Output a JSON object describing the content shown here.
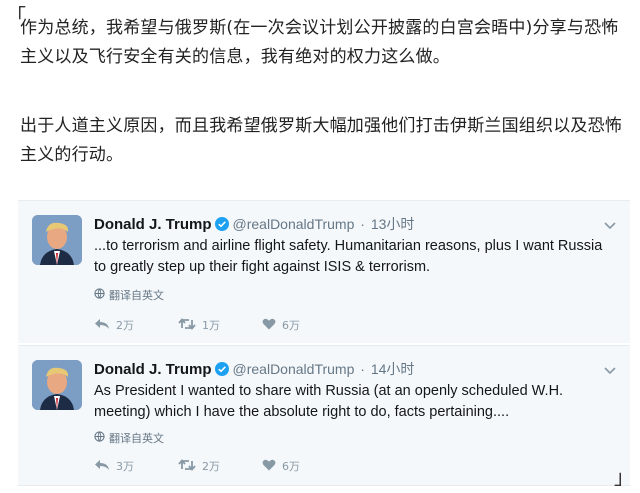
{
  "article": {
    "quote_open": "「",
    "quote_close": "」",
    "paragraph1": "作为总统，我希望与俄罗斯(在一次会议计划公开披露的白宫会晤中)分享与恐怖主义以及飞行安全有关的信息，我有绝对的权力这么做。",
    "paragraph2": "出于人道主义原因，而且我希望俄罗斯大幅加强他们打击伊斯兰国组织以及恐怖主义的行动。"
  },
  "tweets": [
    {
      "name": "Donald J. Trump",
      "handle": "@realDonaldTrump",
      "separator": "·",
      "time": "13小时",
      "text": "...to terrorism and airline flight safety. Humanitarian reasons, plus I want Russia to greatly step up their fight against ISIS & terrorism.",
      "translate_label": "翻译自英文",
      "replies": "2万",
      "retweets": "1万",
      "likes": "6万"
    },
    {
      "name": "Donald J. Trump",
      "handle": "@realDonaldTrump",
      "separator": "·",
      "time": "14小时",
      "text": "As President I wanted to share with Russia (at an openly scheduled W.H. meeting) which I have the absolute right to do, facts pertaining....",
      "translate_label": "翻译自英文",
      "replies": "3万",
      "retweets": "2万",
      "likes": "6万"
    }
  ],
  "colors": {
    "verified": "#1da1f2",
    "card_background": "#f5f8fa",
    "muted": "#657786",
    "action_icons": "#8899a6"
  },
  "icons": [
    "verified-badge-icon",
    "chevron-down-icon",
    "globe-icon",
    "reply-icon",
    "retweet-icon",
    "like-icon"
  ]
}
